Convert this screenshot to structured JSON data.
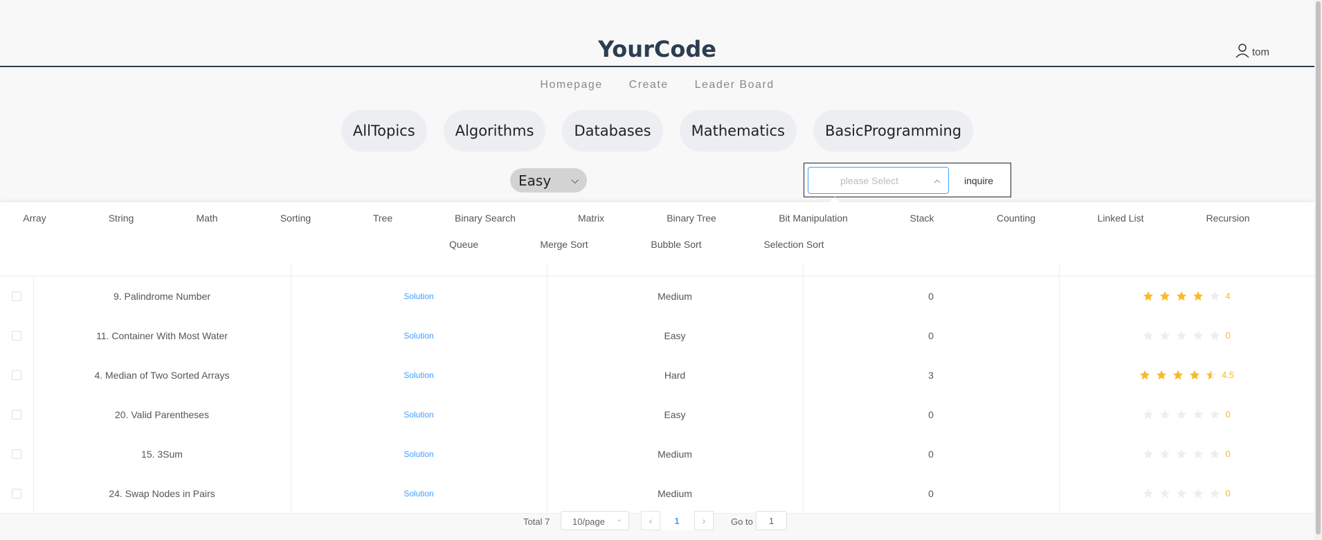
{
  "header": {
    "brand": "YourCode",
    "username": "tom"
  },
  "nav": {
    "items": [
      "Homepage",
      "Create",
      "Leader Board"
    ]
  },
  "topics": [
    "AllTopics",
    "Algorithms",
    "Databases",
    "Mathematics",
    "BasicProgramming"
  ],
  "filters": {
    "difficulty_value": "Easy",
    "tag_placeholder": "please Select",
    "inquire_label": "inquire"
  },
  "tags": {
    "row1": [
      "Array",
      "String",
      "Math",
      "Sorting",
      "Tree",
      "Binary Search",
      "Matrix",
      "Binary Tree",
      "Bit Manipulation",
      "Stack",
      "Counting",
      "Linked List",
      "Recursion"
    ],
    "row2": [
      "Queue",
      "Merge Sort",
      "Bubble Sort",
      "Selection Sort"
    ]
  },
  "problems": [
    {
      "title": "9. Palindrome Number",
      "solution": "Solution",
      "difficulty": "Medium",
      "count": "0",
      "rating": 4,
      "rating_label": "4"
    },
    {
      "title": "11. Container With Most Water",
      "solution": "Solution",
      "difficulty": "Easy",
      "count": "0",
      "rating": 0,
      "rating_label": "0"
    },
    {
      "title": "4. Median of Two Sorted Arrays",
      "solution": "Solution",
      "difficulty": "Hard",
      "count": "3",
      "rating": 4.5,
      "rating_label": "4.5"
    },
    {
      "title": "20. Valid Parentheses",
      "solution": "Solution",
      "difficulty": "Easy",
      "count": "0",
      "rating": 0,
      "rating_label": "0"
    },
    {
      "title": "15. 3Sum",
      "solution": "Solution",
      "difficulty": "Medium",
      "count": "0",
      "rating": 0,
      "rating_label": "0"
    },
    {
      "title": "24. Swap Nodes in Pairs",
      "solution": "Solution",
      "difficulty": "Medium",
      "count": "0",
      "rating": 0,
      "rating_label": "0"
    }
  ],
  "pagination": {
    "total": "Total 7",
    "page_size": "10/page",
    "current_page": "1",
    "goto_label": "Go to",
    "goto_value": "1"
  },
  "colors": {
    "accent": "#409eff",
    "star_on": "#f7ba2a",
    "star_off": "#eceef2",
    "brand": "#2c3e50"
  },
  "icons": {
    "user": "user-icon",
    "select_arrow": "chevron-up-icon",
    "prev": "chevron-left-icon",
    "next": "chevron-right-icon"
  }
}
